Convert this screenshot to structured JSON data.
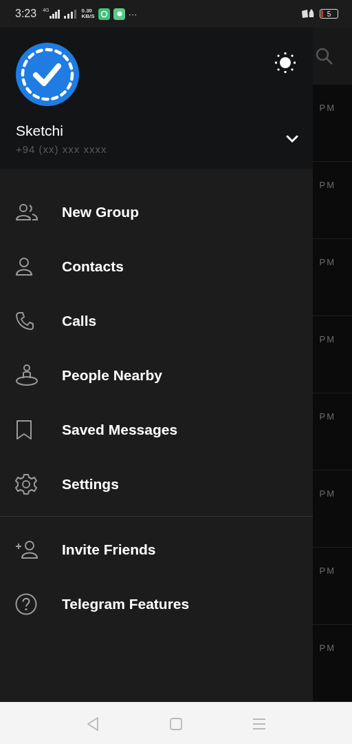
{
  "status_bar": {
    "time": "3:23",
    "network": "4G",
    "speed_value": "0.30",
    "speed_unit": "KB/S",
    "more": "···",
    "battery": "5"
  },
  "background_chats": [
    {
      "time": "PM"
    },
    {
      "time": "PM"
    },
    {
      "time": "PM"
    },
    {
      "time": "PM"
    },
    {
      "time": "PM"
    },
    {
      "time": "PM"
    },
    {
      "time": "PM"
    },
    {
      "time": "PM"
    }
  ],
  "drawer": {
    "account": {
      "name": "Sketchi",
      "phone": "+94 (xx) xxx xxxx",
      "expanded": false
    },
    "menu": [
      {
        "kind": "group",
        "label": "New Group"
      },
      {
        "kind": "contact",
        "label": "Contacts"
      },
      {
        "kind": "phone",
        "label": "Calls"
      },
      {
        "kind": "nearby",
        "label": "People Nearby"
      },
      {
        "kind": "bookmark",
        "label": "Saved Messages"
      },
      {
        "kind": "gear",
        "label": "Settings"
      }
    ],
    "extra": [
      {
        "kind": "add-person",
        "label": "Invite Friends"
      },
      {
        "kind": "question",
        "label": "Telegram Features"
      }
    ]
  }
}
